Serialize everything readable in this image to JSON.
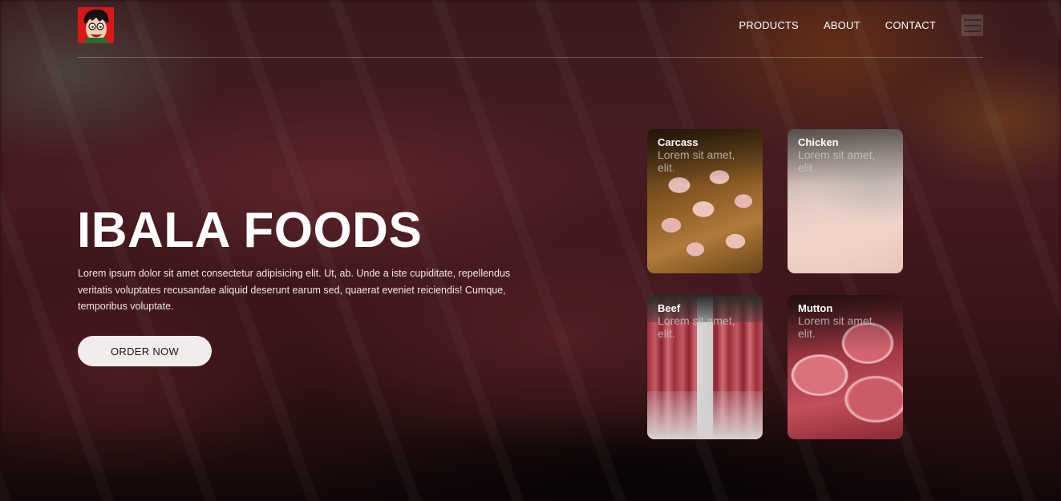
{
  "header": {
    "logo_icon": "cartoon-avatar-logo",
    "nav": {
      "products": "PRODUCTS",
      "about": "ABOUT",
      "contact": "CONTACT"
    },
    "menu_icon": "hamburger-menu-icon"
  },
  "hero": {
    "title": "IBALA FOODS",
    "description": "Lorem ipsum dolor sit amet consectetur adipisicing elit. Ut, ab. Unde a iste cupiditate, repellendus veritatis voluptates recusandae aliquid deserunt earum sed, quaerat eveniet reiciendis! Cumque, temporibus voluptate.",
    "order_button": "ORDER NOW"
  },
  "products": [
    {
      "title": "Carcass",
      "description": "Lorem sit amet, elit."
    },
    {
      "title": "Chicken",
      "description": "Lorem sit amet, elit."
    },
    {
      "title": "Beef",
      "description": "Lorem sit amet, elit."
    },
    {
      "title": "Mutton",
      "description": "Lorem sit amet, elit."
    }
  ],
  "colors": {
    "text": "#ffffff",
    "button_bg": "#f3eced",
    "button_text": "#1a1a1a",
    "logo_bg": "#d81818"
  }
}
